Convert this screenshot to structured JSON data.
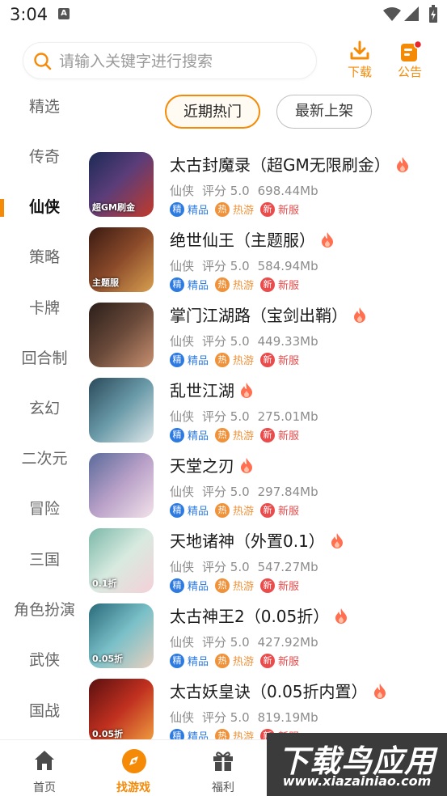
{
  "status_bar": {
    "time": "3:04"
  },
  "search": {
    "placeholder": "请输入关键字进行搜索"
  },
  "header_actions": {
    "download_label": "下载",
    "notice_label": "公告"
  },
  "categories": [
    {
      "label": "精选",
      "active": false
    },
    {
      "label": "传奇",
      "active": false
    },
    {
      "label": "仙侠",
      "active": true
    },
    {
      "label": "策略",
      "active": false
    },
    {
      "label": "卡牌",
      "active": false
    },
    {
      "label": "回合制",
      "active": false
    },
    {
      "label": "玄幻",
      "active": false
    },
    {
      "label": "二次元",
      "active": false
    },
    {
      "label": "冒险",
      "active": false
    },
    {
      "label": "三国",
      "active": false
    },
    {
      "label": "角色扮演",
      "active": false
    },
    {
      "label": "武侠",
      "active": false
    },
    {
      "label": "国战",
      "active": false
    }
  ],
  "tabs": {
    "hot": "近期热门",
    "new": "最新上架",
    "active": "hot"
  },
  "tag_labels": {
    "jing_badge": "精",
    "jing_text": "精品",
    "re_badge": "热",
    "re_text": "热游",
    "xin_badge": "新",
    "xin_text": "新服"
  },
  "games": [
    {
      "title": "太古封魔录（超GM无限刷金）",
      "genre": "仙侠",
      "rating": "评分 5.0",
      "size": "698.44Mb",
      "icon_label": "超GM刷金"
    },
    {
      "title": "绝世仙王（主题服）",
      "genre": "仙侠",
      "rating": "评分 5.0",
      "size": "584.94Mb",
      "icon_label": "主题服"
    },
    {
      "title": "掌门江湖路（宝剑出鞘）",
      "genre": "仙侠",
      "rating": "评分 5.0",
      "size": "449.33Mb",
      "icon_label": ""
    },
    {
      "title": "乱世江湖",
      "genre": "仙侠",
      "rating": "评分 5.0",
      "size": "275.01Mb",
      "icon_label": ""
    },
    {
      "title": "天堂之刃",
      "genre": "仙侠",
      "rating": "评分 5.0",
      "size": "297.84Mb",
      "icon_label": ""
    },
    {
      "title": "天地诸神（外置0.1）",
      "genre": "仙侠",
      "rating": "评分 5.0",
      "size": "547.27Mb",
      "icon_label": "0.1折"
    },
    {
      "title": "太古神王2（0.05折）",
      "genre": "仙侠",
      "rating": "评分 5.0",
      "size": "427.92Mb",
      "icon_label": "0.05折"
    },
    {
      "title": "太古妖皇诀（0.05折内置）",
      "genre": "仙侠",
      "rating": "评分 5.0",
      "size": "819.19Mb",
      "icon_label": "0.05折"
    }
  ],
  "bottom_nav": {
    "home": "首页",
    "find": "找游戏",
    "welfare": "福利",
    "active": "find"
  },
  "watermark": {
    "line1": "下载鸟应用",
    "line2": "www.xiazainiao.com"
  },
  "colors": {
    "accent": "#f58a07",
    "tag_blue": "#2d7be0",
    "tag_orange": "#f0923a",
    "tag_red": "#ea4b4b"
  }
}
